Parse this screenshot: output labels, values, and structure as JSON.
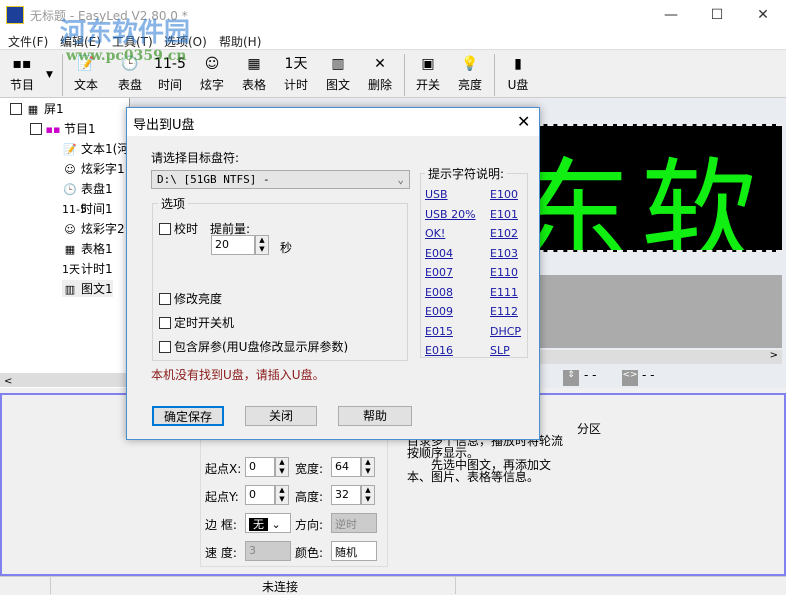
{
  "window": {
    "title": "无标题 - EasyLed V2.80.0 *",
    "minimize": "—",
    "maximize": "☐",
    "close": "✕"
  },
  "watermark": {
    "text": "河东软件园",
    "url": "www.pc0359.cn"
  },
  "menu": [
    "文件(F)",
    "编辑(E)",
    "工具(T)",
    "选项(O)",
    "帮助(H)"
  ],
  "toolbar": [
    {
      "label": "节目",
      "icon": "program-icon",
      "glyph": "▪▪"
    },
    {
      "label": "文本",
      "icon": "text-icon",
      "glyph": "📝"
    },
    {
      "label": "表盘",
      "icon": "clock-icon",
      "glyph": "🕒"
    },
    {
      "label": "时间",
      "icon": "time-icon",
      "glyph": "11-5"
    },
    {
      "label": "炫字",
      "icon": "smiley-icon",
      "glyph": "☺"
    },
    {
      "label": "表格",
      "icon": "table-icon",
      "glyph": "▦"
    },
    {
      "label": "计时",
      "icon": "timer-icon",
      "glyph": "1天"
    },
    {
      "label": "图文",
      "icon": "picture-text-icon",
      "glyph": "▥"
    },
    {
      "label": "删除",
      "icon": "delete-icon",
      "glyph": "✕"
    },
    {
      "label": "开关",
      "icon": "power-icon",
      "glyph": "▣"
    },
    {
      "label": "亮度",
      "icon": "bulb-icon",
      "glyph": "💡"
    },
    {
      "label": "U盘",
      "icon": "usb-icon",
      "glyph": "▮"
    }
  ],
  "tree": {
    "screen": "屏1",
    "program": "节目1",
    "items": [
      {
        "label": "文本1(河",
        "glyph": "📝"
      },
      {
        "label": "炫彩字1",
        "glyph": "☺"
      },
      {
        "label": "表盘1",
        "glyph": "🕒"
      },
      {
        "label": "时间1",
        "glyph": "11-5"
      },
      {
        "label": "炫彩字2",
        "glyph": "☺"
      },
      {
        "label": "表格1",
        "glyph": "▦"
      },
      {
        "label": "计时1",
        "glyph": "1天"
      },
      {
        "label": "图文1",
        "glyph": "▥"
      }
    ]
  },
  "led_text": "东软件园",
  "preview_status": {
    "v": "- -",
    "h": "- -"
  },
  "props": {
    "x_label": "起点X:",
    "x": "0",
    "w_label": "宽度:",
    "w": "64",
    "y_label": "起点Y:",
    "y": "0",
    "h_label": "高度:",
    "h": "32",
    "border_label": "边 框:",
    "border": "无",
    "dir_label": "方向:",
    "dir": "逆时",
    "speed_label": "速 度:",
    "speed": "3",
    "color_label": "颜色:",
    "color": "随机"
  },
  "help_text": [
    "分区",
    "目录多个信息，播放时将轮流",
    "按顺序显示。",
    "　　先选中图文，再添加文",
    "本、图片、表格等信息。"
  ],
  "status": "未连接",
  "dialog": {
    "title": "导出到U盘",
    "drive_label": "请选择目标盘符:",
    "drive": "D:\\ [51GB NTFS] -",
    "options_label": "选项",
    "sync_time": "校时",
    "advance_label": "提前量:",
    "advance": "20",
    "seconds": "秒",
    "brightness": "修改亮度",
    "timer_switch": "定时开关机",
    "screen_params": "包含屏参(用U盘修改显示屏参数)",
    "error": "本机没有找到U盘，请插入U盘。",
    "hint_label": "提示字符说明:",
    "hints_left": [
      "USB",
      "USB 20%",
      "OK!",
      "E004",
      "E007",
      "E008",
      "E009",
      "E015",
      "E016"
    ],
    "hints_right": [
      "E100",
      "E101",
      "E102",
      "E103",
      "E110",
      "E111",
      "E112",
      "DHCP",
      "SLP"
    ],
    "ok": "确定保存",
    "close": "关闭",
    "help": "帮助"
  }
}
